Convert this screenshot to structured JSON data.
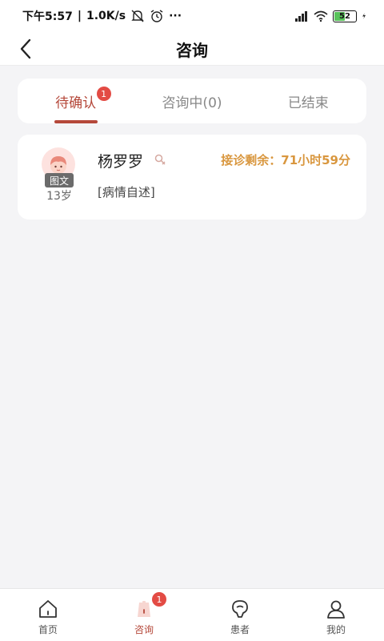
{
  "status_bar": {
    "time": "下午5:57",
    "speed": "1.0K/s",
    "more": "···",
    "battery": "52",
    "battery_level": 0.52
  },
  "header": {
    "title": "咨询"
  },
  "tabs": [
    {
      "label": "待确认",
      "badge": "1",
      "active": true
    },
    {
      "label": "咨询中(0)",
      "active": false
    },
    {
      "label": "已结束",
      "active": false
    }
  ],
  "consultations": [
    {
      "avatar_tag": "图文",
      "age": "13岁",
      "name": "杨罗罗",
      "remaining": "接诊剩余：71小时59分",
      "complaint": "[病情自述]"
    }
  ],
  "bottom_nav": [
    {
      "label": "首页",
      "icon": "home-icon",
      "active": false
    },
    {
      "label": "咨询",
      "icon": "consult-icon",
      "active": true,
      "badge": "1"
    },
    {
      "label": "患者",
      "icon": "patient-icon",
      "active": false
    },
    {
      "label": "我的",
      "icon": "profile-icon",
      "active": false
    }
  ],
  "colors": {
    "accent": "#b5483a",
    "badge": "#e34b44",
    "remaining": "#d9973f",
    "background": "#f4f4f6"
  }
}
